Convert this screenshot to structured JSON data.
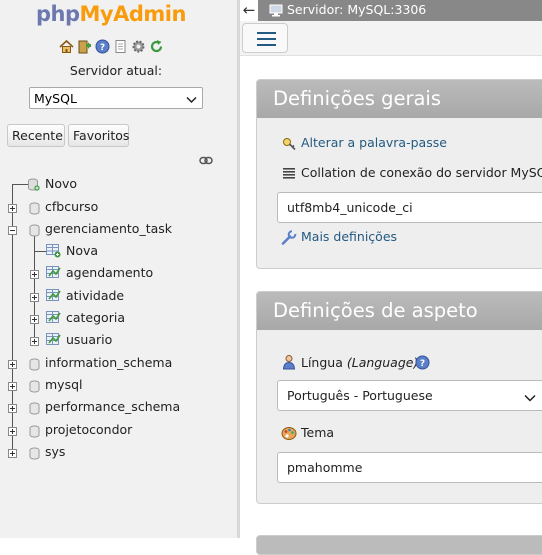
{
  "logo": {
    "part1": "php",
    "part2": "MyAdmin"
  },
  "navigation": {
    "quick_icons": [
      "home-icon",
      "exit-icon",
      "help-icon",
      "docs-icon",
      "settings-icon",
      "reload-icon"
    ],
    "server_label": "Servidor atual:",
    "server_select_value": "MySQL",
    "tabs": [
      "Recente",
      "Favoritos"
    ],
    "tree": {
      "new": "Novo",
      "databases": [
        {
          "name": "cfbcurso"
        },
        {
          "name": "gerenciamento_task",
          "new": "Nova",
          "tables": [
            "agendamento",
            "atividade",
            "categoria",
            "usuario"
          ]
        },
        {
          "name": "information_schema"
        },
        {
          "name": "mysql"
        },
        {
          "name": "performance_schema"
        },
        {
          "name": "projetocondor"
        },
        {
          "name": "sys"
        }
      ]
    }
  },
  "topbar": {
    "server": "Servidor: MySQL:3306",
    "back_arrow": "←"
  },
  "general_settings": {
    "title": "Definições gerais",
    "change_password": "Alterar a palavra-passe",
    "collation_label": "Collation de conexão do servidor MySQL:",
    "collation_value": "utf8mb4_unicode_ci",
    "more_settings": "Mais definições"
  },
  "appearance_settings": {
    "title": "Definições de aspeto",
    "language_label": "Língua",
    "language_label_en": "(Language)",
    "language_value": "Português - Portuguese",
    "theme_label": "Tema",
    "theme_value": "pmahomme"
  },
  "colors": {
    "logo_php": "#6c78af",
    "logo_admin": "#f89c0e",
    "link": "#235a81",
    "topbar": "#888888"
  }
}
